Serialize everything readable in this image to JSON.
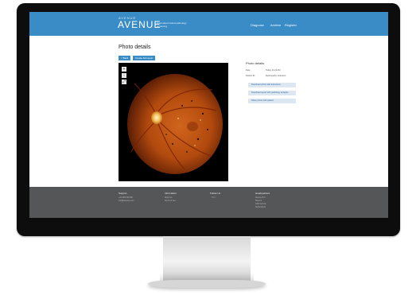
{
  "header": {
    "brand_small": "AVENUE",
    "brand": "AVENUE",
    "tagline": "Automated retinal pathology screening",
    "nav": [
      "Diagnose",
      "Archive",
      "Register"
    ]
  },
  "main": {
    "title": "Photo details",
    "buttons": [
      "< Back",
      "Create full report"
    ],
    "zoom": [
      "+",
      "-",
      "⤢"
    ],
    "info": {
      "heading": "Photo details",
      "rows": [
        {
          "label": "Date",
          "value": "Today 11:24 AM"
        },
        {
          "label": "Patient ID",
          "value": "Retinopathy Unknown"
        }
      ],
      "actions": [
        "Download photo with detections",
        "Download report with pathology analysis",
        "Share photo with patient"
      ]
    }
  },
  "footer": {
    "columns": [
      {
        "heading": "Support",
        "items": [
          "+31 000 000 000",
          "info@avenue.com"
        ]
      },
      {
        "heading": "Information",
        "items": [
          "About us",
          "Terms of use"
        ]
      },
      {
        "heading": "Follow Us",
        "items": [
          "f  t  in"
        ]
      },
      {
        "heading": "Headquarters",
        "items": [
          "Avenue B.V.",
          "Street 1",
          "1000 AA City",
          "Netherlands"
        ]
      }
    ]
  },
  "colors": {
    "accent": "#3a8cc6",
    "footer": "#555657"
  }
}
